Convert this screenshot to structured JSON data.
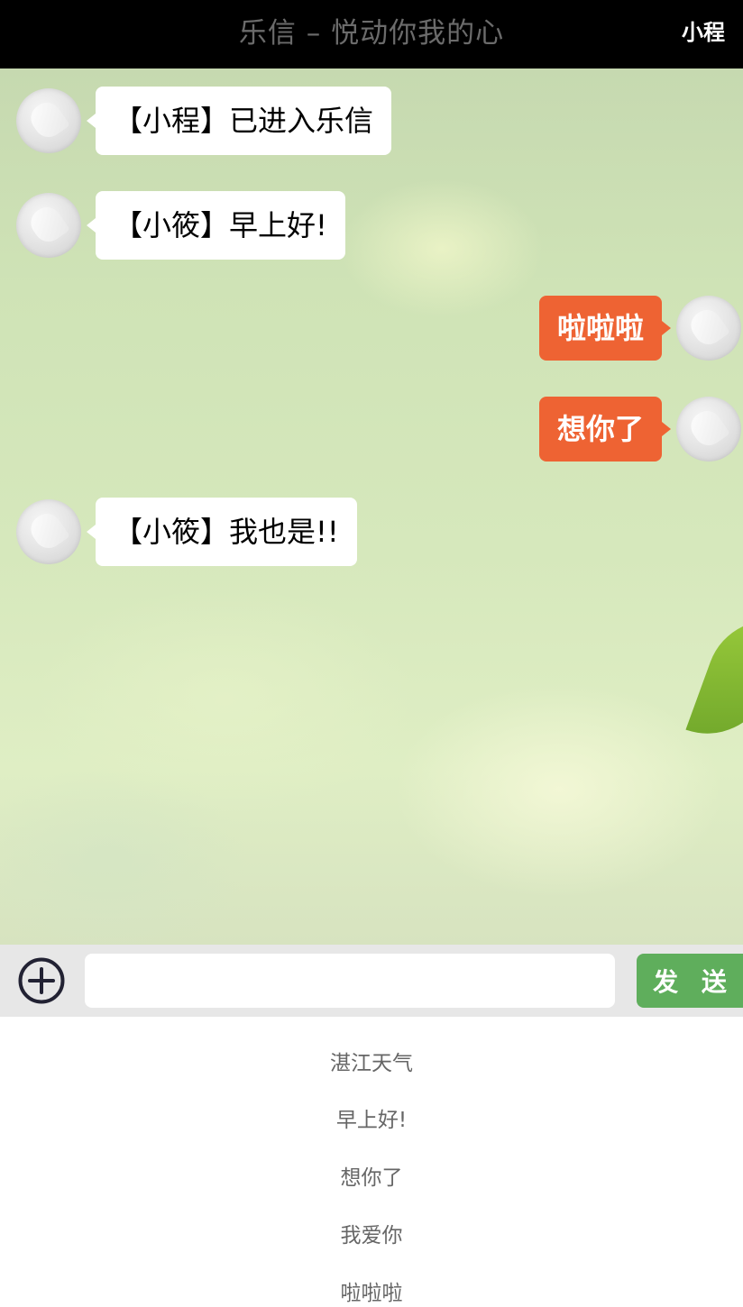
{
  "header": {
    "title": "乐信 – 悦动你我的心",
    "username": "小程"
  },
  "messages": [
    {
      "side": "left",
      "text": "【小程】已进入乐信"
    },
    {
      "side": "left",
      "text": "【小筱】早上好!"
    },
    {
      "side": "right",
      "text": "啦啦啦"
    },
    {
      "side": "right",
      "text": "想你了"
    },
    {
      "side": "left",
      "text": "【小筱】我也是!!"
    }
  ],
  "input": {
    "value": "",
    "placeholder": ""
  },
  "toolbar": {
    "send_label": "发 送",
    "plus_icon": "plus-circle-icon"
  },
  "quick_replies": [
    "湛江天气",
    "早上好!",
    "想你了",
    "我爱你",
    "啦啦啦"
  ],
  "colors": {
    "header_bg": "#000000",
    "sent_bubble": "#ee6333",
    "send_button": "#5fae5c",
    "received_bubble": "#ffffff"
  }
}
